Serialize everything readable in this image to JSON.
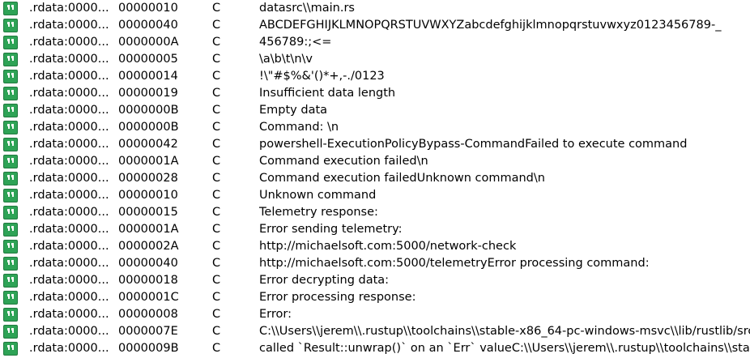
{
  "rows": [
    {
      "address": ".rdata:0000...",
      "length": "00000010",
      "type": "C",
      "string": "datasrc\\\\main.rs"
    },
    {
      "address": ".rdata:0000...",
      "length": "00000040",
      "type": "C",
      "string": "ABCDEFGHIJKLMNOPQRSTUVWXYZabcdefghijklmnopqrstuvwxyz0123456789-_"
    },
    {
      "address": ".rdata:0000...",
      "length": "0000000A",
      "type": "C",
      "string": "456789:;<="
    },
    {
      "address": ".rdata:0000...",
      "length": "00000005",
      "type": "C",
      "string": "\\a\\b\\t\\n\\v"
    },
    {
      "address": ".rdata:0000...",
      "length": "00000014",
      "type": "C",
      "string": " !\\\"#$%&'()*+,-./0123"
    },
    {
      "address": ".rdata:0000...",
      "length": "00000019",
      "type": "C",
      "string": "Insufficient data length"
    },
    {
      "address": ".rdata:0000...",
      "length": "0000000B",
      "type": "C",
      "string": "Empty data"
    },
    {
      "address": ".rdata:0000...",
      "length": "0000000B",
      "type": "C",
      "string": "Command: \\n"
    },
    {
      "address": ".rdata:0000...",
      "length": "00000042",
      "type": "C",
      "string": "powershell-ExecutionPolicyBypass-CommandFailed to execute command"
    },
    {
      "address": ".rdata:0000...",
      "length": "0000001A",
      "type": "C",
      "string": "Command execution failed\\n"
    },
    {
      "address": ".rdata:0000...",
      "length": "00000028",
      "type": "C",
      "string": "Command execution failedUnknown command\\n"
    },
    {
      "address": ".rdata:0000...",
      "length": "00000010",
      "type": "C",
      "string": "Unknown command"
    },
    {
      "address": ".rdata:0000...",
      "length": "00000015",
      "type": "C",
      "string": "Telemetry response: "
    },
    {
      "address": ".rdata:0000...",
      "length": "0000001A",
      "type": "C",
      "string": "Error sending telemetry: "
    },
    {
      "address": ".rdata:0000...",
      "length": "0000002A",
      "type": "C",
      "string": "http://michaelsoft.com:5000/network-check"
    },
    {
      "address": ".rdata:0000...",
      "length": "00000040",
      "type": "C",
      "string": "http://michaelsoft.com:5000/telemetryError processing command: "
    },
    {
      "address": ".rdata:0000...",
      "length": "00000018",
      "type": "C",
      "string": "Error decrypting data: "
    },
    {
      "address": ".rdata:0000...",
      "length": "0000001C",
      "type": "C",
      "string": "Error processing response: "
    },
    {
      "address": ".rdata:0000...",
      "length": "00000008",
      "type": "C",
      "string": "Error: "
    },
    {
      "address": ".rdata:0000...",
      "length": "0000007E",
      "type": "C",
      "string": "C:\\\\Users\\\\jerem\\\\.rustup\\\\toolchains\\\\stable-x86_64-pc-windows-msvc\\\\lib/rustlib/src"
    },
    {
      "address": ".rdata:0000...",
      "length": "0000009B",
      "type": "C",
      "string": "called `Result::unwrap()` on an `Err` valueC:\\\\Users\\\\jerem\\\\.rustup\\\\toolchains\\\\stable"
    }
  ],
  "row_icon": "string-quote-icon",
  "colors": {
    "icon_bg": "#2ea356",
    "icon_border": "#1f7a3e",
    "icon_glyph": "#ffffff",
    "text": "#000000",
    "background": "#ffffff"
  }
}
